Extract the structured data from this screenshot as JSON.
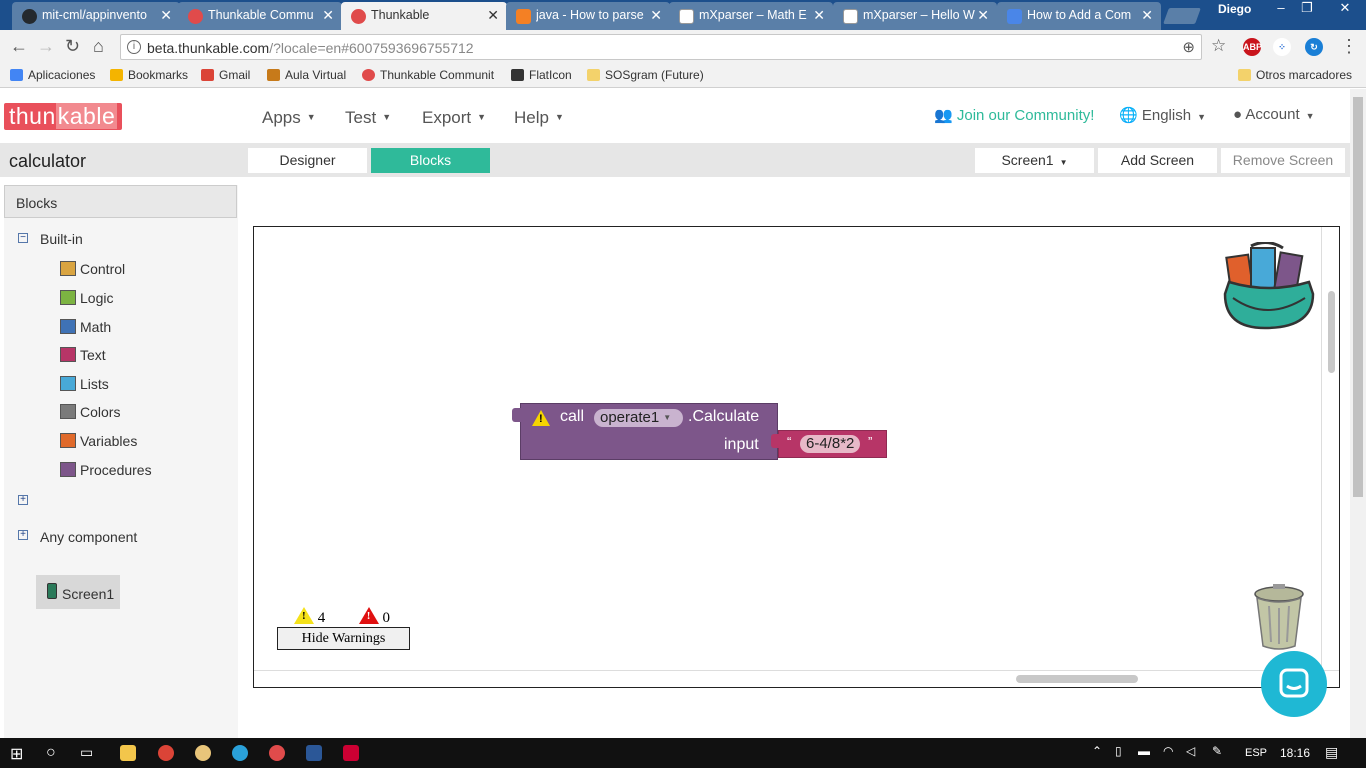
{
  "browser": {
    "tabs": [
      {
        "title": "mit-cml/appinvento",
        "color": "#24292e"
      },
      {
        "title": "Thunkable Commu",
        "color": "#e04b4b"
      },
      {
        "title": "Thunkable",
        "color": "#e04b4b"
      },
      {
        "title": "java - How to parse",
        "color": "#f48024"
      },
      {
        "title": "mXparser – Math E",
        "color": "#ffffff"
      },
      {
        "title": "mXparser – Hello W",
        "color": "#ffffff"
      },
      {
        "title": "How to Add a Com",
        "color": "#4a86e8"
      }
    ],
    "user": "Diego",
    "url_host": "beta.thunkable.com",
    "url_rest": "/?locale=en#6007593696755712",
    "bookmarks": [
      "Aplicaciones",
      "Bookmarks",
      "Gmail",
      "Aula Virtual",
      "Thunkable Communit",
      "FlatIcon",
      "SOSgram (Future)",
      "Otros marcadores"
    ],
    "extensions": [
      "ABP"
    ]
  },
  "app": {
    "logo_left": "thun",
    "logo_right": "kable",
    "menu": [
      "Apps",
      "Test",
      "Export",
      "Help"
    ],
    "community": "Join our Community!",
    "language": "English",
    "account": "Account",
    "project_name": "calculator",
    "designer_btn": "Designer",
    "blocks_btn": "Blocks",
    "screen_select": "Screen1",
    "add_screen": "Add Screen",
    "remove_screen": "Remove Screen"
  },
  "left_panel": {
    "header": "Blocks",
    "builtin": "Built-in",
    "categories": [
      {
        "label": "Control",
        "color": "#d9a441"
      },
      {
        "label": "Logic",
        "color": "#7cb342"
      },
      {
        "label": "Math",
        "color": "#3f72b5"
      },
      {
        "label": "Text",
        "color": "#b73567"
      },
      {
        "label": "Lists",
        "color": "#48a9d8"
      },
      {
        "label": "Colors",
        "color": "#7a7a7a"
      },
      {
        "label": "Variables",
        "color": "#e06a2b"
      },
      {
        "label": "Procedures",
        "color": "#7d568a"
      }
    ],
    "screen": "Screen1",
    "any_component": "Any component"
  },
  "workspace": {
    "call": "call",
    "component": "operate1",
    "method": ".Calculate",
    "input_label": "input",
    "string_open": "“",
    "string_value": "6-4/8*2",
    "string_close": "”",
    "warnings_count": "4",
    "errors_count": "0",
    "hide_warnings": "Hide Warnings"
  },
  "taskbar": {
    "lang": "ESP",
    "time": "18:16"
  }
}
